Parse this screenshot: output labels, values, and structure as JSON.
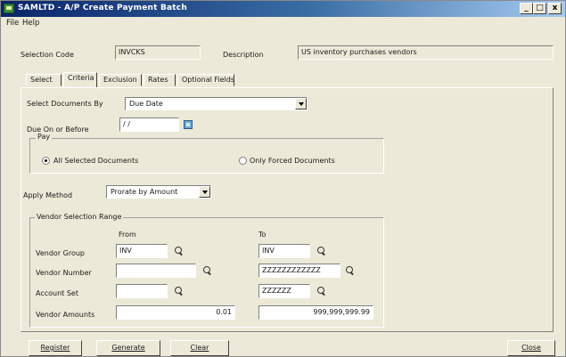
{
  "window": {
    "title": "SAMLTD - A/P Create Payment Batch",
    "controls": {
      "minimize": "_",
      "maximize": "□",
      "close": "x"
    }
  },
  "menu": {
    "file": "File",
    "help": "Help"
  },
  "header": {
    "selection_code_label": "Selection Code",
    "selection_code_value": "INVCKS",
    "description_label": "Description",
    "description_value": "US inventory purchases vendors"
  },
  "tabs": [
    "Select",
    "Criteria",
    "Exclusion",
    "Rates",
    "Optional Fields"
  ],
  "active_tab": "Criteria",
  "criteria": {
    "select_documents_by_label": "Select Documents By",
    "select_documents_by_value": "Due Date",
    "due_on_or_before_label": "Due On or Before",
    "due_on_or_before_value": "/ /",
    "pay_group_label": "Pay",
    "pay_options": [
      "All Selected Documents",
      "Only Forced Documents"
    ],
    "pay_selected": "All Selected Documents",
    "apply_method_label": "Apply Method",
    "apply_method_value": "Prorate by Amount",
    "vendor_range_label": "Vendor Selection Range",
    "from_label": "From",
    "to_label": "To",
    "rows": [
      {
        "label": "Vendor Group",
        "from": "INV",
        "to": "INV"
      },
      {
        "label": "Vendor Number",
        "from": "",
        "to": "ZZZZZZZZZZZZ"
      },
      {
        "label": "Account Set",
        "from": "",
        "to": "ZZZZZZ"
      },
      {
        "label": "Vendor Amounts",
        "from": "0.01",
        "to": "999,999,999.99"
      }
    ]
  },
  "buttons": {
    "register": "Register",
    "generate": "Generate",
    "clear": "Clear",
    "close": "Close"
  }
}
